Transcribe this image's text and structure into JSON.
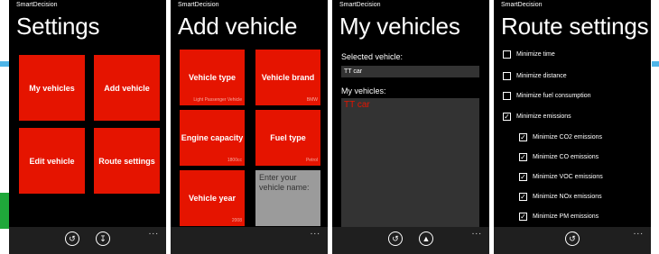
{
  "app": {
    "name": "SmartDecision"
  },
  "colors": {
    "accent": "#e51400",
    "background": "#000000",
    "appbar": "#1f1f1f",
    "input_tile": "#9b9b9b"
  },
  "screens": {
    "settings": {
      "title": "Settings",
      "tiles": [
        "My vehicles",
        "Add vehicle",
        "Edit vehicle",
        "Route settings"
      ],
      "appbar_icons": [
        "back-icon",
        "download-icon"
      ],
      "more": "..."
    },
    "add_vehicle": {
      "title": "Add vehicle",
      "tiles": [
        {
          "label": "Vehicle type",
          "sub": "Light Passenger Vehicle"
        },
        {
          "label": "Vehicle brand",
          "sub": "BMW"
        },
        {
          "label": "Engine capacity",
          "sub": "1800cc"
        },
        {
          "label": "Fuel type",
          "sub": "Petrol"
        },
        {
          "label": "Vehicle year",
          "sub": "2008"
        }
      ],
      "name_input": {
        "placeholder": "Enter your vehicle name:"
      },
      "more": "..."
    },
    "my_vehicles": {
      "title": "My vehicles",
      "selected_label": "Selected vehicle:",
      "selected_value": "TT car",
      "list_label": "My vehicles:",
      "list_items": [
        "TT car"
      ],
      "appbar_icons": [
        "back-icon",
        "brush-icon"
      ],
      "more": "..."
    },
    "route_settings": {
      "title": "Route settings",
      "options": [
        {
          "label": "Minimize time",
          "checked": false
        },
        {
          "label": "Minimize distance",
          "checked": false
        },
        {
          "label": "Minimize fuel consumption",
          "checked": false
        },
        {
          "label": "Minimize emissions",
          "checked": true
        }
      ],
      "sub_options": [
        {
          "label": "Minimize CO2 emissions",
          "checked": true
        },
        {
          "label": "Minimize CO emissions",
          "checked": true
        },
        {
          "label": "Minimize VOC emissions",
          "checked": true
        },
        {
          "label": "Minimize NOx emissions",
          "checked": true
        },
        {
          "label": "Minimize PM emissions",
          "checked": true
        }
      ],
      "appbar_icons": [
        "back-icon"
      ],
      "more": "..."
    }
  }
}
